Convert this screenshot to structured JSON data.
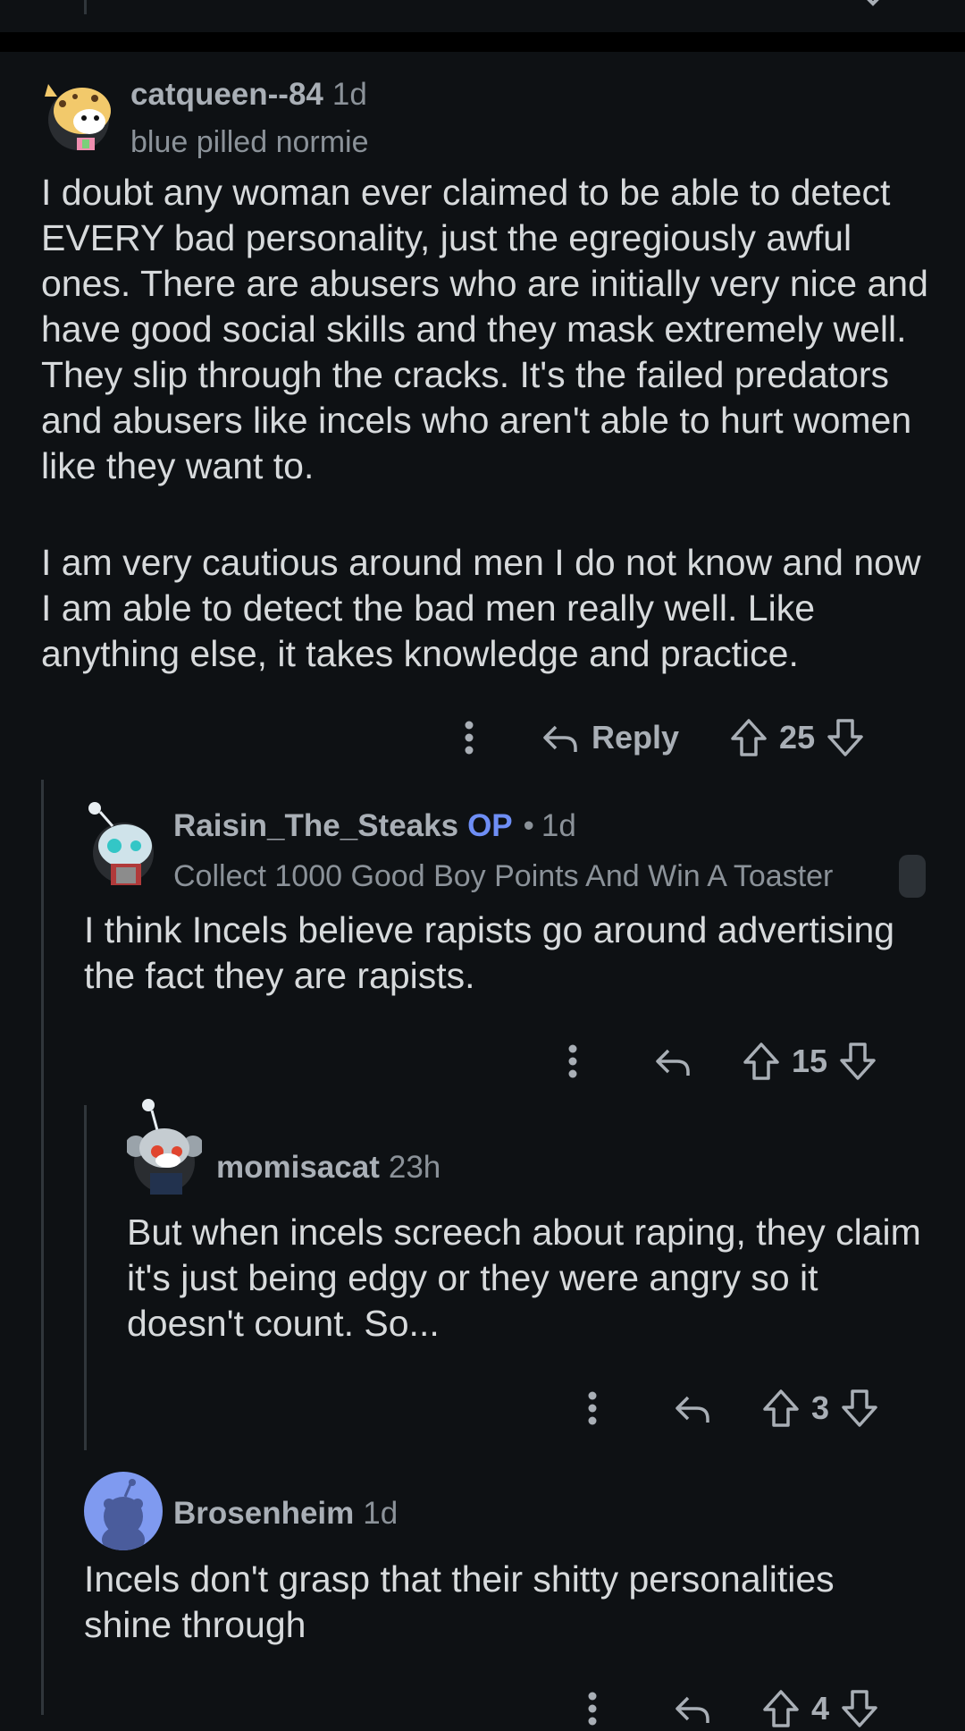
{
  "top_actions": {
    "partial": true
  },
  "comments": [
    {
      "username": "catqueen--84",
      "age": "1d",
      "flair": "blue pilled normie",
      "paragraphs": [
        "I doubt any woman ever claimed to be able to detect EVERY bad personality, just the egregiously awful ones. There are abusers who are initially very nice and have good social skills and they mask extremely well. They slip through the cracks. It's the failed predators and abusers like incels who aren't able to hurt women like they want to.",
        "I am very cautious around men I do not know and now I am able to detect the bad men really well. Like anything else, it takes knowledge and practice."
      ],
      "reply_label": "Reply",
      "votes": "25"
    },
    {
      "username": "Raisin_The_Steaks",
      "op_badge": "OP",
      "separator": "•",
      "age": "1d",
      "flair": "Collect 1000 Good Boy Points And Win A Toaster",
      "paragraphs": [
        "I think Incels believe rapists go around advertising the fact they are rapists."
      ],
      "votes": "15"
    },
    {
      "username": "momisacat",
      "age": "23h",
      "paragraphs": [
        "But when incels screech about raping, they claim it's just being edgy or they were angry so it doesn't count. So..."
      ],
      "votes": "3"
    },
    {
      "username": "Brosenheim",
      "age": "1d",
      "paragraphs": [
        "Incels don't grasp that their shitty personalities shine through"
      ],
      "votes": "4"
    }
  ],
  "colors": {
    "background": "#0e1114",
    "text": "#d7dadc",
    "muted": "#8b9299",
    "op_blue": "#6e8ef5",
    "thread_line": "#30363b"
  },
  "icons": [
    "more-icon",
    "reply-icon",
    "upvote-icon",
    "downvote-icon"
  ]
}
